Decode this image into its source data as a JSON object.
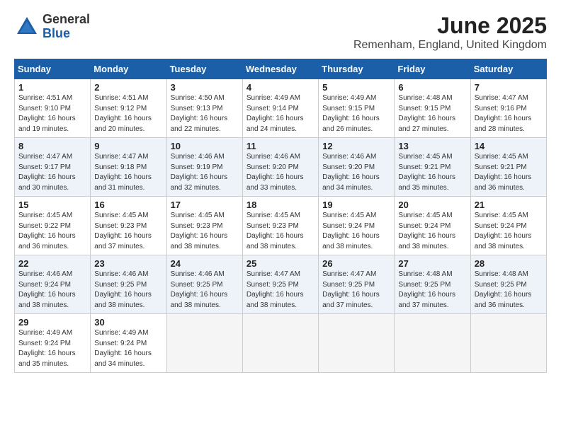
{
  "header": {
    "logo_general": "General",
    "logo_blue": "Blue",
    "month_year": "June 2025",
    "location": "Remenham, England, United Kingdom"
  },
  "days_of_week": [
    "Sunday",
    "Monday",
    "Tuesday",
    "Wednesday",
    "Thursday",
    "Friday",
    "Saturday"
  ],
  "weeks": [
    [
      {
        "day": "1",
        "sunrise": "4:51 AM",
        "sunset": "9:10 PM",
        "daylight": "16 hours and 19 minutes."
      },
      {
        "day": "2",
        "sunrise": "4:51 AM",
        "sunset": "9:12 PM",
        "daylight": "16 hours and 20 minutes."
      },
      {
        "day": "3",
        "sunrise": "4:50 AM",
        "sunset": "9:13 PM",
        "daylight": "16 hours and 22 minutes."
      },
      {
        "day": "4",
        "sunrise": "4:49 AM",
        "sunset": "9:14 PM",
        "daylight": "16 hours and 24 minutes."
      },
      {
        "day": "5",
        "sunrise": "4:49 AM",
        "sunset": "9:15 PM",
        "daylight": "16 hours and 26 minutes."
      },
      {
        "day": "6",
        "sunrise": "4:48 AM",
        "sunset": "9:15 PM",
        "daylight": "16 hours and 27 minutes."
      },
      {
        "day": "7",
        "sunrise": "4:47 AM",
        "sunset": "9:16 PM",
        "daylight": "16 hours and 28 minutes."
      }
    ],
    [
      {
        "day": "8",
        "sunrise": "4:47 AM",
        "sunset": "9:17 PM",
        "daylight": "16 hours and 30 minutes."
      },
      {
        "day": "9",
        "sunrise": "4:47 AM",
        "sunset": "9:18 PM",
        "daylight": "16 hours and 31 minutes."
      },
      {
        "day": "10",
        "sunrise": "4:46 AM",
        "sunset": "9:19 PM",
        "daylight": "16 hours and 32 minutes."
      },
      {
        "day": "11",
        "sunrise": "4:46 AM",
        "sunset": "9:20 PM",
        "daylight": "16 hours and 33 minutes."
      },
      {
        "day": "12",
        "sunrise": "4:46 AM",
        "sunset": "9:20 PM",
        "daylight": "16 hours and 34 minutes."
      },
      {
        "day": "13",
        "sunrise": "4:45 AM",
        "sunset": "9:21 PM",
        "daylight": "16 hours and 35 minutes."
      },
      {
        "day": "14",
        "sunrise": "4:45 AM",
        "sunset": "9:21 PM",
        "daylight": "16 hours and 36 minutes."
      }
    ],
    [
      {
        "day": "15",
        "sunrise": "4:45 AM",
        "sunset": "9:22 PM",
        "daylight": "16 hours and 36 minutes."
      },
      {
        "day": "16",
        "sunrise": "4:45 AM",
        "sunset": "9:23 PM",
        "daylight": "16 hours and 37 minutes."
      },
      {
        "day": "17",
        "sunrise": "4:45 AM",
        "sunset": "9:23 PM",
        "daylight": "16 hours and 38 minutes."
      },
      {
        "day": "18",
        "sunrise": "4:45 AM",
        "sunset": "9:23 PM",
        "daylight": "16 hours and 38 minutes."
      },
      {
        "day": "19",
        "sunrise": "4:45 AM",
        "sunset": "9:24 PM",
        "daylight": "16 hours and 38 minutes."
      },
      {
        "day": "20",
        "sunrise": "4:45 AM",
        "sunset": "9:24 PM",
        "daylight": "16 hours and 38 minutes."
      },
      {
        "day": "21",
        "sunrise": "4:45 AM",
        "sunset": "9:24 PM",
        "daylight": "16 hours and 38 minutes."
      }
    ],
    [
      {
        "day": "22",
        "sunrise": "4:46 AM",
        "sunset": "9:24 PM",
        "daylight": "16 hours and 38 minutes."
      },
      {
        "day": "23",
        "sunrise": "4:46 AM",
        "sunset": "9:25 PM",
        "daylight": "16 hours and 38 minutes."
      },
      {
        "day": "24",
        "sunrise": "4:46 AM",
        "sunset": "9:25 PM",
        "daylight": "16 hours and 38 minutes."
      },
      {
        "day": "25",
        "sunrise": "4:47 AM",
        "sunset": "9:25 PM",
        "daylight": "16 hours and 38 minutes."
      },
      {
        "day": "26",
        "sunrise": "4:47 AM",
        "sunset": "9:25 PM",
        "daylight": "16 hours and 37 minutes."
      },
      {
        "day": "27",
        "sunrise": "4:48 AM",
        "sunset": "9:25 PM",
        "daylight": "16 hours and 37 minutes."
      },
      {
        "day": "28",
        "sunrise": "4:48 AM",
        "sunset": "9:25 PM",
        "daylight": "16 hours and 36 minutes."
      }
    ],
    [
      {
        "day": "29",
        "sunrise": "4:49 AM",
        "sunset": "9:24 PM",
        "daylight": "16 hours and 35 minutes."
      },
      {
        "day": "30",
        "sunrise": "4:49 AM",
        "sunset": "9:24 PM",
        "daylight": "16 hours and 34 minutes."
      },
      null,
      null,
      null,
      null,
      null
    ]
  ],
  "labels": {
    "sunrise": "Sunrise:",
    "sunset": "Sunset:",
    "daylight": "Daylight:"
  }
}
